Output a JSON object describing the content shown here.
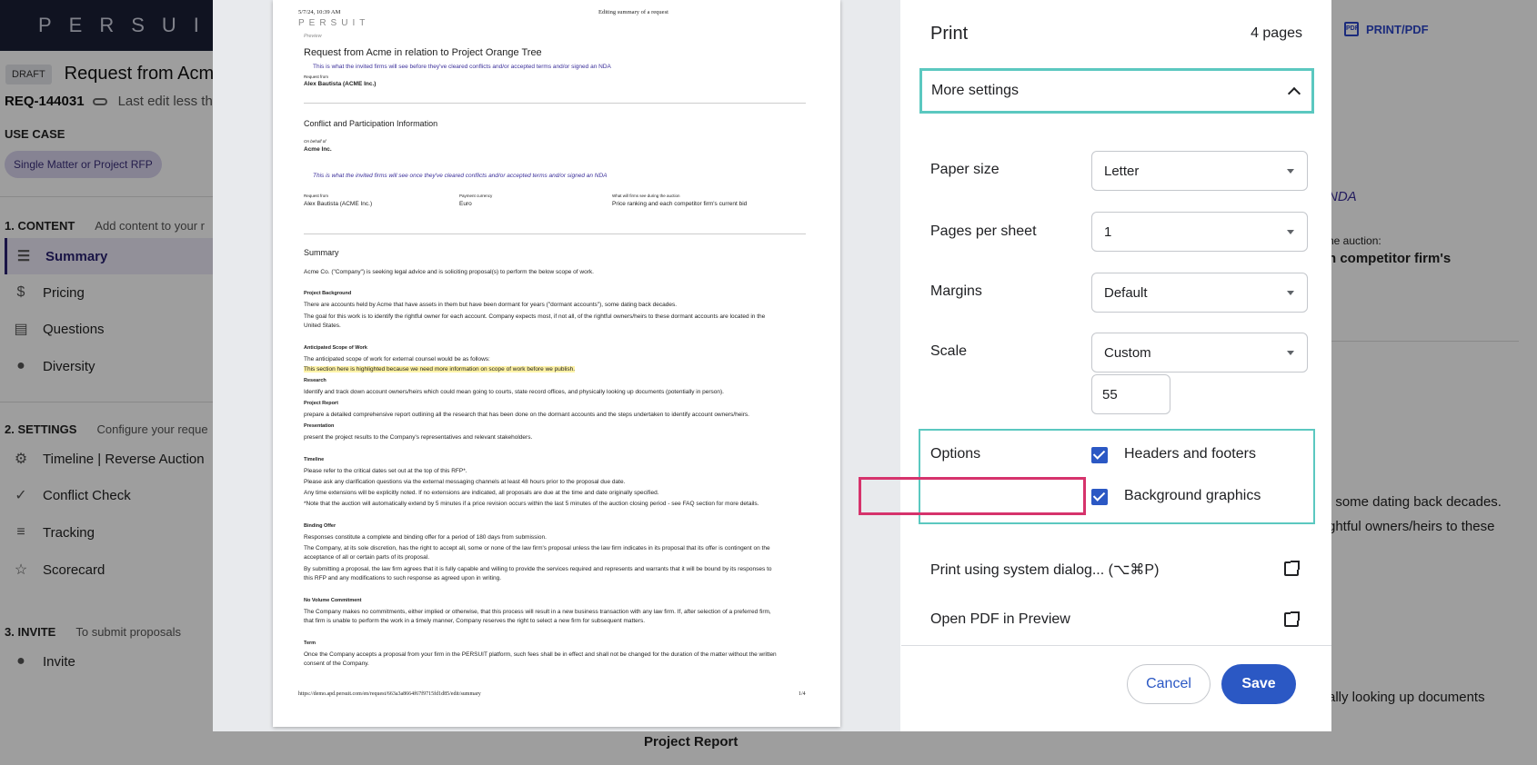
{
  "app": {
    "brand": "PERSUIT",
    "status_badge": "DRAFT",
    "request_title": "Request from Acme",
    "request_id": "REQ-144031",
    "last_edit": "Last edit less tha",
    "use_case_label": "USE CASE",
    "use_case_chip": "Single Matter or Project RFP",
    "sections": {
      "content": {
        "label": "1. CONTENT",
        "hint": "Add content to your r"
      },
      "settings": {
        "label": "2. SETTINGS",
        "hint": "Configure your reque"
      },
      "invite": {
        "label": "3. INVITE",
        "hint": "To submit proposals"
      }
    },
    "nav": {
      "summary": "Summary",
      "pricing": "Pricing",
      "questions": "Questions",
      "diversity": "Diversity",
      "timeline": "Timeline | Reverse Auction",
      "conflict": "Conflict Check",
      "tracking": "Tracking",
      "scorecard": "Scorecard",
      "invite": "Invite"
    },
    "print_pdf": "PRINT/PDF",
    "pdf_icon_text": "PDF",
    "bg_snippets": {
      "nda": "NDA",
      "auction": "he auction:",
      "competitor": "h competitor firm's",
      "decades": ", some dating back decades.",
      "owners": "ghtful owners/heirs to these",
      "looking": "ally looking up documents",
      "project_report": "Project Report"
    }
  },
  "preview": {
    "header_date": "5/7/24, 10:39 AM",
    "header_title": "Editing summary of a request",
    "brand": "PERSUIT",
    "preview_label": "Preview",
    "title": "Request from Acme in relation to Project Orange Tree",
    "notice1": "This is what the invited firms will see before they've cleared conflicts and/or accepted terms and/or signed an NDA",
    "request_from_label": "Request from",
    "request_from": "Alex Bautista (ACME Inc.)",
    "conflict_heading": "Conflict and Participation Information",
    "on_behalf_label": "On behalf of",
    "on_behalf": "Acme Inc.",
    "notice2": "This is what the invited firms will see once they've cleared conflicts and/or accepted terms and/or signed an NDA",
    "request_from_label2": "Request from",
    "request_from2": "Alex Bautista (ACME Inc.)",
    "currency_label": "Payment currency",
    "currency": "Euro",
    "auction_label": "What will firms see during the auction",
    "auction_value": "Price ranking and each competitor firm's current bid",
    "summary_heading": "Summary",
    "summary_intro": "Acme Co. (\"Company\") is seeking legal advice and is soliciting proposal(s) to perform the below scope of work.",
    "bg_heading": "Project Background",
    "bg_line1": "There are accounts held by Acme that have assets in them but have been dormant for years (\"dormant accounts\"), some dating back decades.",
    "bg_line2": "The goal for this work is to identify the rightful owner for each account. Company expects most, if not all, of the rightful owners/heirs to these dormant accounts are located in the",
    "bg_line3": "United States.",
    "scope_heading": "Anticipated Scope of Work",
    "scope_line1": "The anticipated scope of work for external counsel would be as follows:",
    "scope_highlight": "This section here is highlighted because we need more information on scope of work before we publish.",
    "research_heading": "Research",
    "research_line": "Identify and track down account owners/heirs which could mean going to courts, state record offices, and physically looking up documents (potentially in person).",
    "report_heading": "Project Report",
    "report_line": "prepare a detailed comprehensive report outlining all the research that has been done on the dormant accounts and the steps undertaken to identify account owners/heirs.",
    "presentation_heading": "Presentation",
    "presentation_line": "present the project results to the Company's representatives and relevant stakeholders.",
    "timeline_heading": "Timeline",
    "timeline_line1": "Please refer to the critical dates set out at the top of this RFP*.",
    "timeline_line2": "Please ask any clarification questions via the external messaging channels at least 48 hours prior to the proposal due date.",
    "timeline_line3": "Any time extensions will be explicitly noted. If no extensions are indicated, all proposals are due at the time and date originally specified.",
    "timeline_line4": "*Note that the auction will automatically extend by 5 minutes if a price revision occurs within the last 5 minutes of the auction closing period - see FAQ section for more details.",
    "offer_heading": "Binding Offer",
    "offer_line1": "Responses constitute a complete and binding offer for a period of 180 days from submission.",
    "offer_line2": "The Company, at its sole discretion, has the right to accept all, some or none of the law firm's proposal unless the law firm indicates in its proposal that its offer is contingent on the",
    "offer_line3": "acceptance of all or certain parts of its proposal.",
    "offer_line4": "By submitting a proposal, the law firm agrees that it is fully capable and willing to provide the services required and represents and warrants that it will be bound by its responses to",
    "offer_line5": "this RFP and any modifications to such response as agreed upon in writing.",
    "volume_heading": "No Volume Commitment",
    "volume_line1": "The Company makes no commitments, either implied or otherwise, that this process will result in a new business transaction with any law firm. If, after selection of a preferred firm,",
    "volume_line2": "that firm is unable to perform the work in a timely manner, Company reserves the right to select a new firm for subsequent matters.",
    "term_heading": "Term",
    "term_line1": "Once the Company accepts a proposal from your firm in the PERSUIT platform, such fees shall be in effect and shall not be changed for the duration of the matter without the written",
    "term_line2": "consent of the Company.",
    "footer_url": "https://demo.apd.persuit.com/en/request/663a3a8664f67f9715fd1d85/edit/summary",
    "footer_page": "1/4"
  },
  "print": {
    "title": "Print",
    "page_count": "4 pages",
    "more_settings": "More settings",
    "paper_size_label": "Paper size",
    "paper_size_value": "Letter",
    "pages_per_sheet_label": "Pages per sheet",
    "pages_per_sheet_value": "1",
    "margins_label": "Margins",
    "margins_value": "Default",
    "scale_label": "Scale",
    "scale_value": "Custom",
    "scale_custom": "55",
    "options_label": "Options",
    "headers_footers": "Headers and footers",
    "headers_footers_checked": true,
    "background_graphics": "Background graphics",
    "background_graphics_checked": true,
    "system_dialog": "Print using system dialog... (⌥⌘P)",
    "open_pdf": "Open PDF in Preview",
    "cancel": "Cancel",
    "save": "Save"
  },
  "colors": {
    "accent_blue": "#2b58c4",
    "highlight_teal": "#5bc8c0",
    "highlight_pink": "#d6336c",
    "brand_navy": "#1b1f36"
  }
}
